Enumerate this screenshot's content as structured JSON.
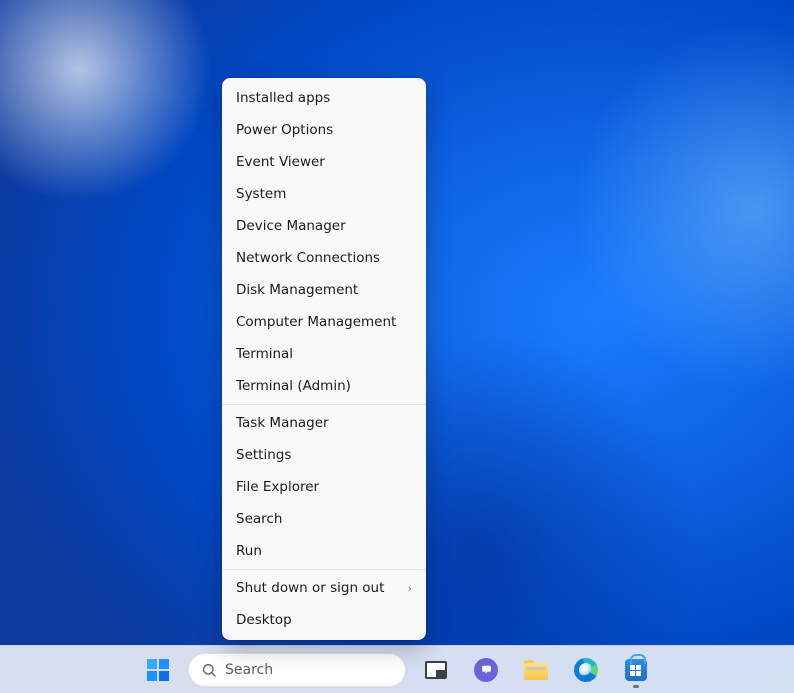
{
  "context_menu": {
    "groups": [
      {
        "items": [
          {
            "key": "installed-apps",
            "label": "Installed apps"
          },
          {
            "key": "power-options",
            "label": "Power Options"
          },
          {
            "key": "event-viewer",
            "label": "Event Viewer"
          },
          {
            "key": "system",
            "label": "System"
          },
          {
            "key": "device-manager",
            "label": "Device Manager"
          },
          {
            "key": "network-connections",
            "label": "Network Connections"
          },
          {
            "key": "disk-management",
            "label": "Disk Management"
          },
          {
            "key": "computer-management",
            "label": "Computer Management"
          },
          {
            "key": "terminal",
            "label": "Terminal"
          },
          {
            "key": "terminal-admin",
            "label": "Terminal (Admin)"
          }
        ]
      },
      {
        "items": [
          {
            "key": "task-manager",
            "label": "Task Manager"
          },
          {
            "key": "settings",
            "label": "Settings"
          },
          {
            "key": "file-explorer",
            "label": "File Explorer"
          },
          {
            "key": "search",
            "label": "Search"
          },
          {
            "key": "run",
            "label": "Run"
          }
        ]
      },
      {
        "items": [
          {
            "key": "shutdown-signout",
            "label": "Shut down or sign out",
            "submenu": true
          },
          {
            "key": "desktop",
            "label": "Desktop"
          }
        ]
      }
    ]
  },
  "taskbar": {
    "search_placeholder": "Search",
    "items": [
      {
        "key": "start",
        "name": "start-button"
      },
      {
        "key": "search",
        "name": "search-box"
      },
      {
        "key": "taskview",
        "name": "task-view-button"
      },
      {
        "key": "chat",
        "name": "chat-button"
      },
      {
        "key": "explorer",
        "name": "file-explorer-button"
      },
      {
        "key": "edge",
        "name": "edge-button"
      },
      {
        "key": "store",
        "name": "microsoft-store-button",
        "running": true
      }
    ]
  }
}
